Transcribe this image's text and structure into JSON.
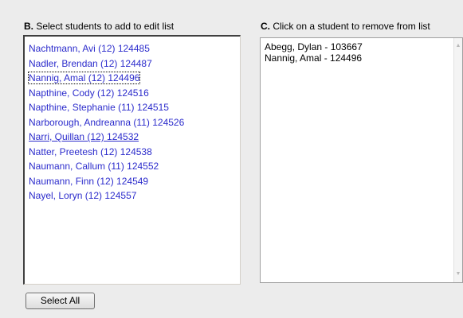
{
  "left_panel": {
    "title_letter": "B.",
    "title_text": " Select students to add to edit list",
    "students": [
      "Nachtmann, Avi (12) 124485",
      "Nadler, Brendan (12) 124487",
      "Nannig, Amal (12) 124496",
      "Napthine, Cody (12) 124516",
      "Napthine, Stephanie (11) 124515",
      "Narborough, Andreanna (11) 124526",
      "Narri, Quillan (12) 124532",
      "Natter, Preetesh (12) 124538",
      "Naumann, Callum (11) 124552",
      "Naumann, Finn (12) 124549",
      "Nayel, Loryn (12) 124557"
    ],
    "select_all_label": "Select All"
  },
  "right_panel": {
    "title_letter": "C.",
    "title_text": " Click on a student to remove from list",
    "students": [
      "Abegg, Dylan - 103667",
      "Nannig, Amal - 124496"
    ]
  },
  "colors": {
    "student_link": "#2c2ccc",
    "background": "#ececec"
  }
}
